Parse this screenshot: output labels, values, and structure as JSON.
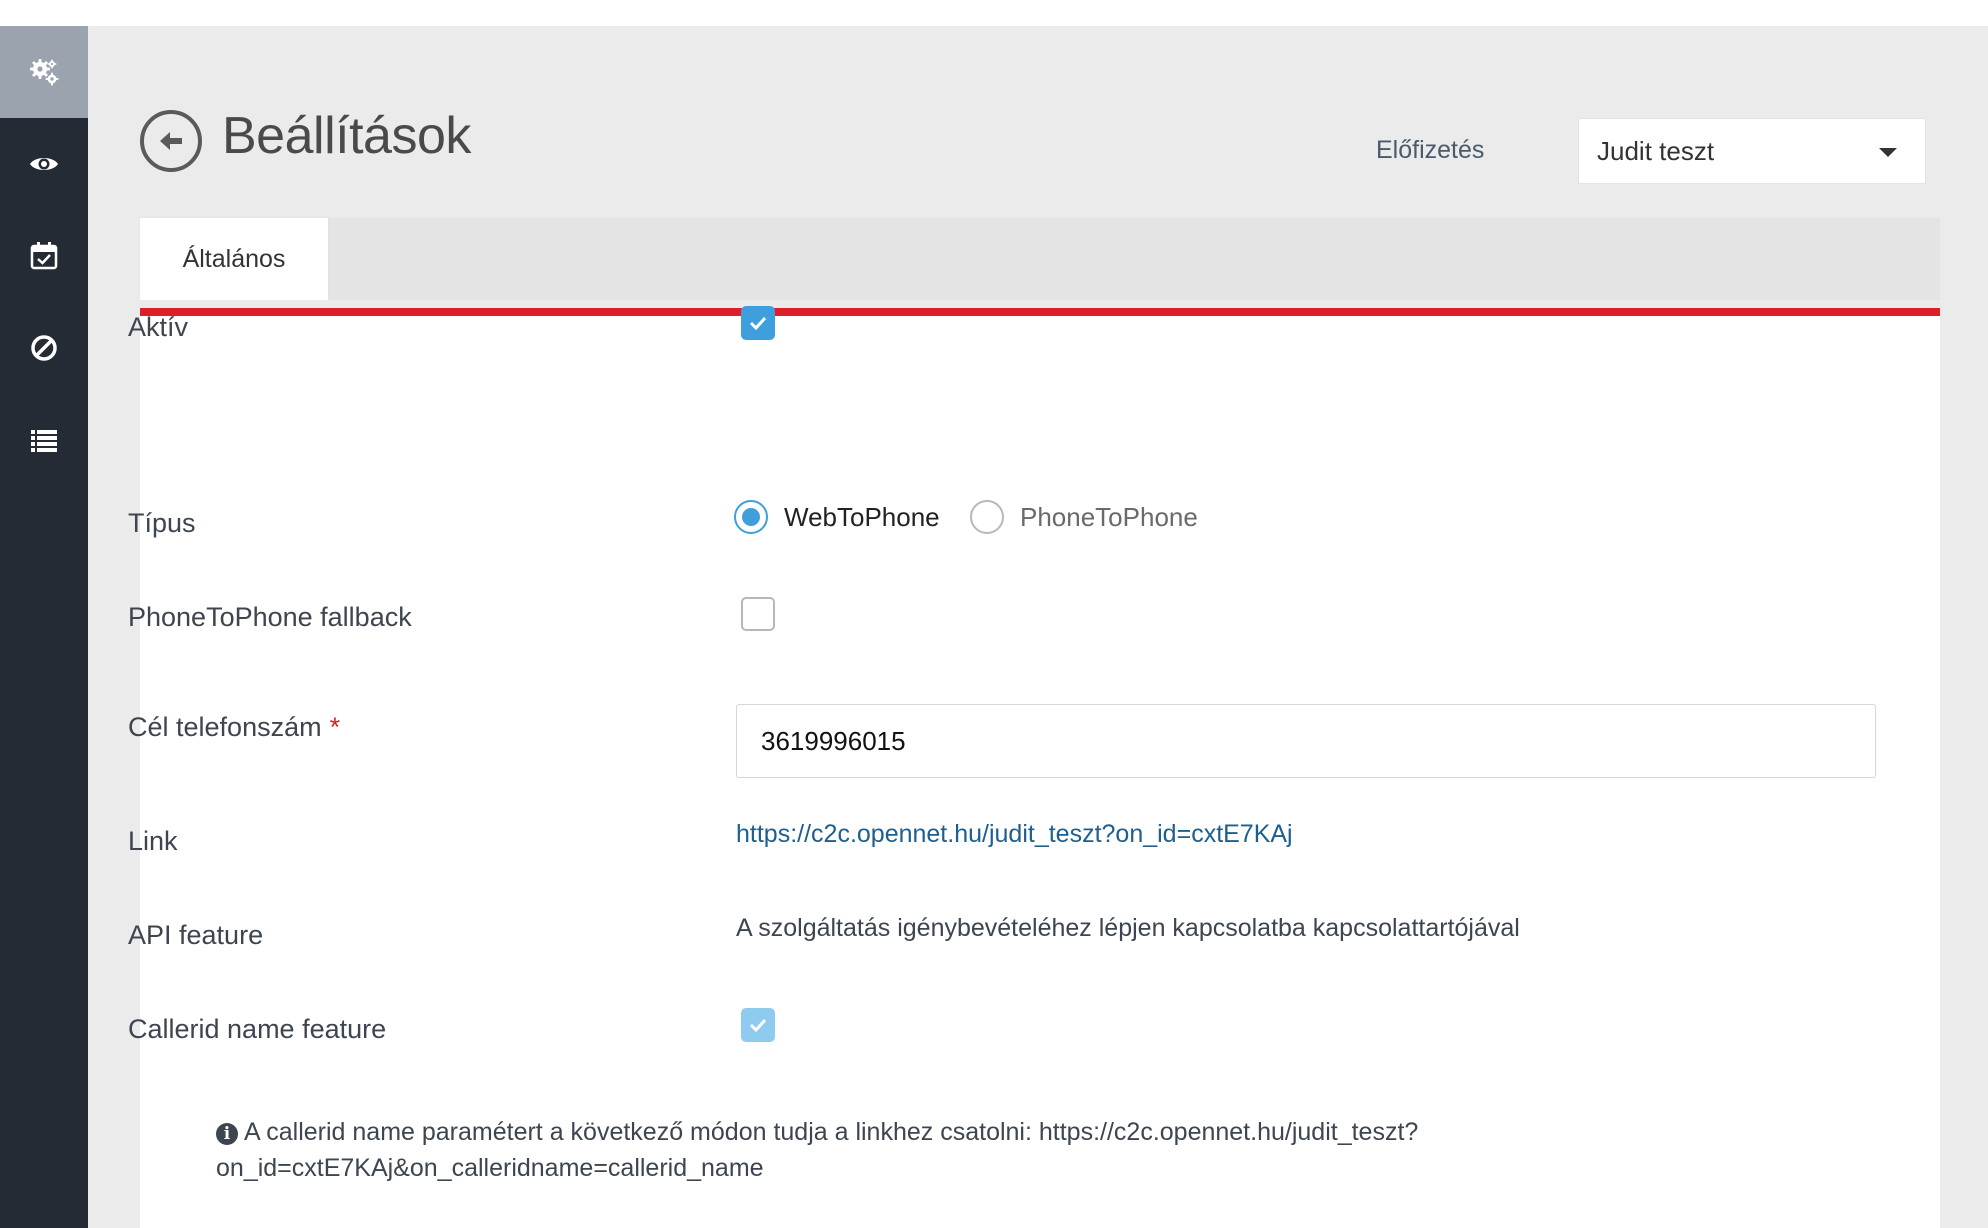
{
  "sidebar": {
    "items": [
      {
        "icon": "gears-icon",
        "active": true
      },
      {
        "icon": "eye-icon",
        "active": false
      },
      {
        "icon": "calendar-check-icon",
        "active": false
      },
      {
        "icon": "ban-icon",
        "active": false
      },
      {
        "icon": "list-icon",
        "active": false
      }
    ]
  },
  "header": {
    "title": "Beállítások",
    "subscription_label": "Előfizetés",
    "subscription_value": "Judit teszt"
  },
  "tabs": [
    {
      "label": "Általános",
      "active": true
    }
  ],
  "form": {
    "active": {
      "label": "Aktív",
      "checked": true
    },
    "type": {
      "label": "Típus",
      "options": [
        {
          "label": "WebToPhone",
          "selected": true
        },
        {
          "label": "PhoneToPhone",
          "selected": false
        }
      ]
    },
    "fallback": {
      "label": "PhoneToPhone fallback",
      "checked": false
    },
    "target_phone": {
      "label": "Cél telefonszám",
      "required_mark": "*",
      "value": "3619996015"
    },
    "link": {
      "label": "Link",
      "url": "https://c2c.opennet.hu/judit_teszt?on_id=cxtE7KAj"
    },
    "api_feature": {
      "label": "API feature",
      "text": "A szolgáltatás igénybevételéhez lépjen kapcsolatba kapcsolattartójával"
    },
    "callerid": {
      "label": "Callerid name feature",
      "checked": true,
      "disabled": true
    },
    "info_text": "A callerid name paramétert a következő módon tudja a linkhez csatolni: https://c2c.opennet.hu/judit_teszt?on_id=cxtE7KAj&on_calleridname=callerid_name"
  },
  "colors": {
    "sidebar_bg": "#252b35",
    "sidebar_active": "#9aa3ae",
    "accent_red": "#dd1f2a",
    "checkbox_blue": "#3f9fdc",
    "link_blue": "#1e5f8e"
  }
}
